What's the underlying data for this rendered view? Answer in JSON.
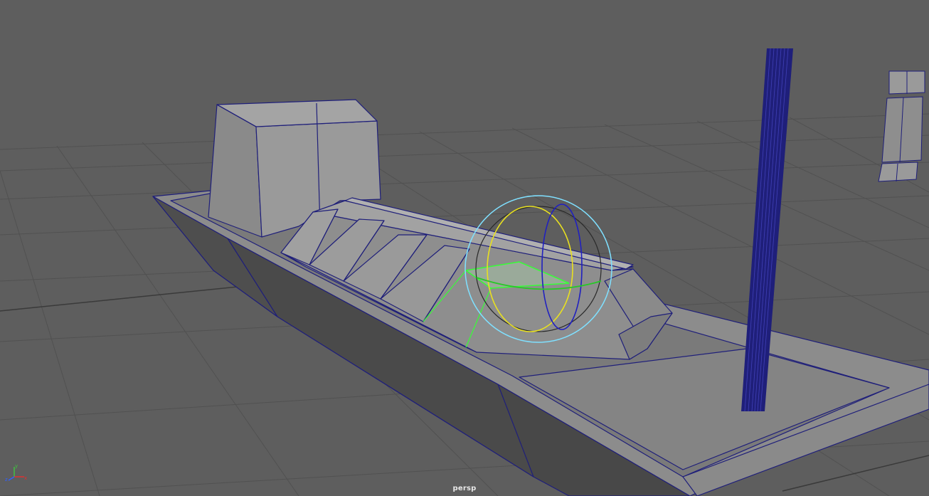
{
  "viewport": {
    "camera_label": "persp",
    "background_color": "#5e5e5e",
    "wireframe_color": "#1f1f7a",
    "selection_color": "#36ff36"
  },
  "manipulator": {
    "icon": "rotate-manipulator-icon",
    "ring_colors": {
      "outer": "#7fe0ff",
      "x": "#e8e020",
      "y": "#2020c0",
      "z": "#28c828",
      "arcball": "#2a2a2a"
    }
  },
  "axis_gizmo": {
    "icon": "xyz-axis-icon",
    "labels": {
      "x": "x",
      "y": "y",
      "z": "z"
    },
    "colors": {
      "x": "#e03030",
      "y": "#40c040",
      "z": "#3060ff"
    }
  }
}
